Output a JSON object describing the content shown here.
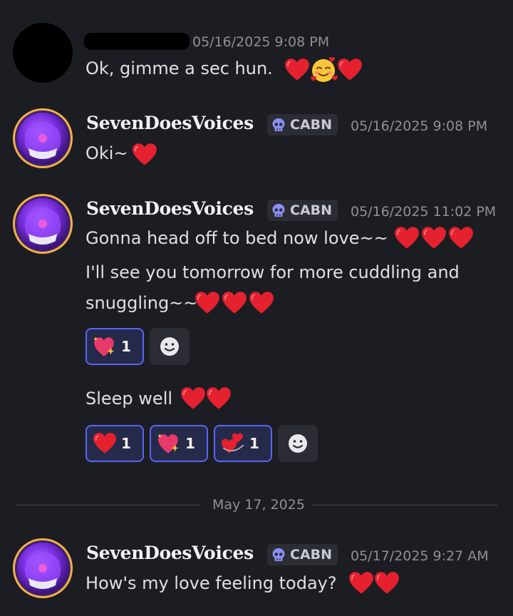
{
  "messages": [
    {
      "author_redacted": true,
      "timestamp": "05/16/2025 9:08 PM",
      "text": "Ok, gimme a sec hun."
    },
    {
      "author": "SevenDoesVoices",
      "tag": "CABN",
      "timestamp": "05/16/2025 9:08 PM",
      "text": "Oki~"
    },
    {
      "author": "SevenDoesVoices",
      "tag": "CABN",
      "timestamp": "05/16/2025 11:02 PM",
      "lines": [
        "Gonna head off to bed now love~~",
        "I'll see you tomorrow for more cuddling and",
        "snuggling~~"
      ],
      "reactions": [
        {
          "emoji": "sparkling-heart-icon",
          "count": "1"
        }
      ]
    },
    {
      "text": "Sleep well",
      "reactions": [
        {
          "emoji": "red-heart-icon",
          "count": "1"
        },
        {
          "emoji": "sparkling-heart-icon",
          "count": "1"
        },
        {
          "emoji": "revolving-hearts-icon",
          "count": "1"
        }
      ]
    },
    {
      "author": "SevenDoesVoices",
      "tag": "CABN",
      "timestamp": "05/17/2025 9:27 AM",
      "text": "How's my love feeling today?"
    }
  ],
  "date_divider": "May 17, 2025",
  "colors": {
    "background": "#1c1d22",
    "heart": "#e5212f",
    "reaction_active_border": "#5865f2",
    "timestamp": "#8e9099"
  }
}
